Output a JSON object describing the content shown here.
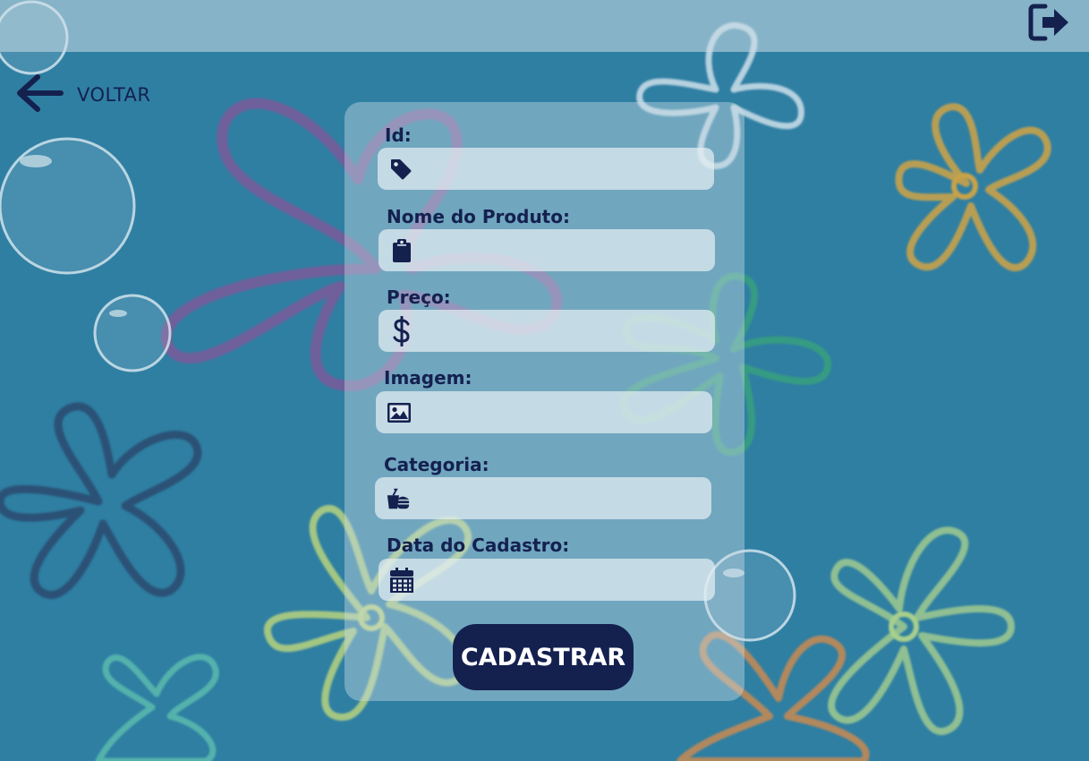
{
  "colors": {
    "primary": "#14214f",
    "background": "#2f7fa3",
    "panel": "#cddee8"
  },
  "header": {
    "logout_icon": "sign-out-icon"
  },
  "nav": {
    "back_label": "VOLTAR",
    "back_icon": "arrow-left-icon"
  },
  "form": {
    "fields": [
      {
        "label": "Id:",
        "icon": "tag-icon",
        "value": "",
        "placeholder": ""
      },
      {
        "label": "Nome do Produto:",
        "icon": "clipboard-icon",
        "value": "",
        "placeholder": ""
      },
      {
        "label": "Preço:",
        "icon": "dollar-icon",
        "value": "",
        "placeholder": ""
      },
      {
        "label": "Imagem:",
        "icon": "image-icon",
        "value": "",
        "placeholder": ""
      },
      {
        "label": "Categoria:",
        "icon": "food-icon",
        "value": "",
        "placeholder": ""
      },
      {
        "label": "Data do Cadastro:",
        "icon": "calendar-icon",
        "value": "",
        "placeholder": ""
      }
    ],
    "submit_label": "CADASTRAR"
  }
}
